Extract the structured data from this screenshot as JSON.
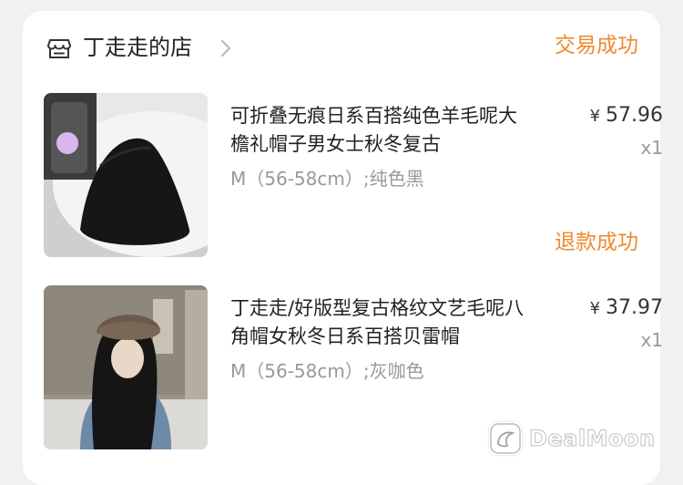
{
  "store": {
    "name": "丁走走的店",
    "icon": "store-icon"
  },
  "orders": [
    {
      "status": "交易成功",
      "title": "可折叠无痕日系百搭纯色羊毛呢大檐礼帽子男女士秋冬复古",
      "variant": "M（56-58cm）;纯色黑",
      "currency": "¥",
      "price": "57.96",
      "quantity": "x1"
    },
    {
      "status": "退款成功",
      "title": "丁走走/好版型复古格纹文艺毛呢八角帽女秋冬日系百搭贝雷帽",
      "variant": "M（56-58cm）;灰咖色",
      "currency": "¥",
      "price": "37.97",
      "quantity": "x1"
    }
  ],
  "watermark": {
    "text": "DealMoon"
  },
  "colors": {
    "status_orange": "#ef8a2e",
    "text_primary": "#222222",
    "text_secondary": "#999999",
    "background": "#f1f1f1"
  }
}
